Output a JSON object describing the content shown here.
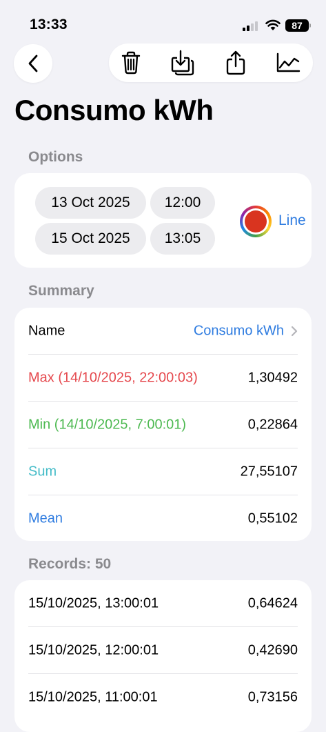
{
  "status_bar": {
    "time": "13:33",
    "battery": "87"
  },
  "nav": {
    "back_icon": "chevron-left-icon",
    "actions": [
      "trash-icon",
      "download-icon",
      "share-icon",
      "chart-icon"
    ]
  },
  "title": "Consumo kWh",
  "options": {
    "header": "Options",
    "start_date": "13 Oct 2025",
    "start_time": "12:00",
    "end_date": "15 Oct 2025",
    "end_time": "13:05",
    "color": "#d9341f",
    "chart_type": "Line"
  },
  "summary": {
    "header": "Summary",
    "name_label": "Name",
    "name_value": "Consumo kWh",
    "max_label": "Max (14/10/2025, 22:00:03)",
    "max_value": "1,30492",
    "min_label": "Min (14/10/2025, 7:00:01)",
    "min_value": "0,22864",
    "sum_label": "Sum",
    "sum_value": "27,55107",
    "mean_label": "Mean",
    "mean_value": "0,55102",
    "colors": {
      "max": "#e5484d",
      "min": "#4cb950",
      "sum": "#45bcc8",
      "mean": "#2f7ce0",
      "link": "#2f7ce0"
    }
  },
  "records": {
    "header": "Records: 50",
    "items": [
      {
        "time": "15/10/2025, 13:00:01",
        "value": "0,64624"
      },
      {
        "time": "15/10/2025, 12:00:01",
        "value": "0,42690"
      },
      {
        "time": "15/10/2025, 11:00:01",
        "value": "0,73156"
      }
    ]
  }
}
